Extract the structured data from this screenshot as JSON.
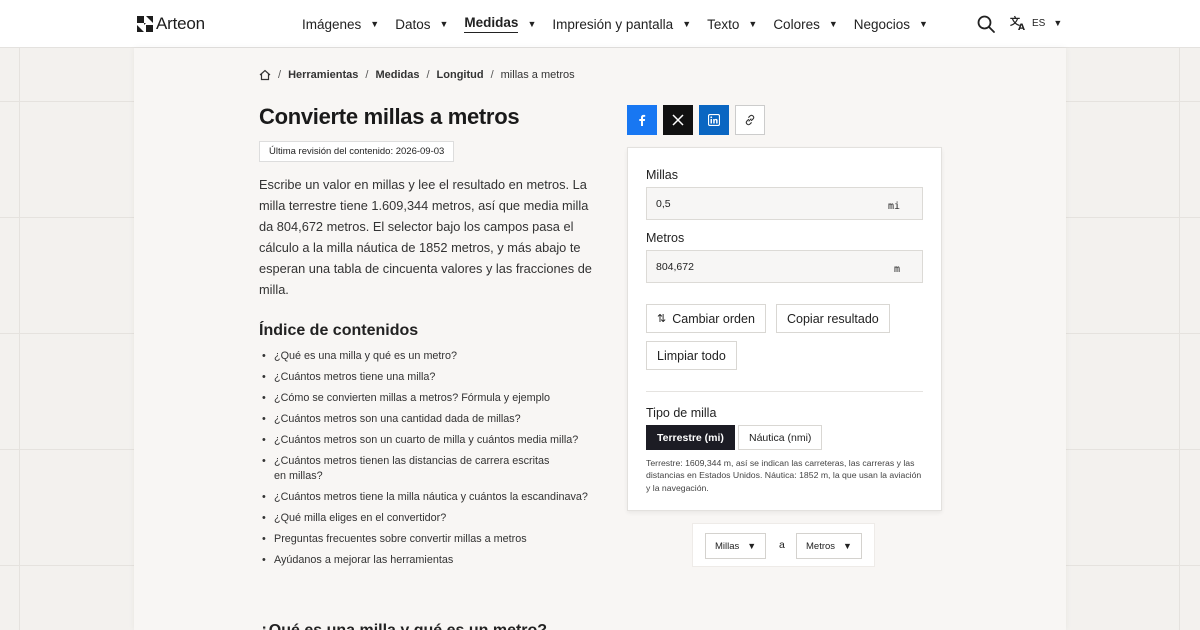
{
  "brand": {
    "name": "Arteon"
  },
  "nav": {
    "items": [
      {
        "label": "Imágenes"
      },
      {
        "label": "Datos"
      },
      {
        "label": "Medidas",
        "active": true
      },
      {
        "label": "Impresión y pantalla"
      },
      {
        "label": "Texto"
      },
      {
        "label": "Colores"
      },
      {
        "label": "Negocios"
      }
    ],
    "caret": "▼",
    "search_icon": "search-icon",
    "language": {
      "code": "ES",
      "icon": "translate-icon"
    }
  },
  "breadcrumb": {
    "home_icon": "home-icon",
    "items": [
      "Herramientas",
      "Medidas",
      "Longitud"
    ],
    "current": "millas a metros",
    "separator": "/"
  },
  "page": {
    "title": "Convierte millas a metros",
    "revision": "Última revisión del contenido: 2026-09-03",
    "intro": "Escribe un valor en millas y lee el resultado en metros. La milla terrestre tiene 1.609,344 metros, así que media milla da 804,672 metros. El selector bajo los campos pasa el cálculo a la milla náutica de 1852 metros, y más abajo te esperan una tabla de cincuenta valores y las fracciones de milla.",
    "toc_title": "Índice de contenidos",
    "toc": [
      "¿Qué es una milla y qué es un metro?",
      "¿Cuántos metros tiene una milla?",
      "¿Cómo se convierten millas a metros? Fórmula y ejemplo",
      "¿Cuántos metros son una cantidad dada de millas?",
      "¿Cuántos metros son un cuarto de milla y cuántos media milla?",
      "¿Cuántos metros tienen las distancias de carrera escritas en millas?",
      "¿Cuántos metros tiene la milla náutica y cuántos la escandinava?",
      "¿Qué milla eliges en el convertidor?",
      "Preguntas frecuentes sobre convertir millas a metros",
      "Ayúdanos a mejorar las herramientas"
    ],
    "next_heading": "¿Qué es una milla y qué es un metro?"
  },
  "share": {
    "icons": [
      "facebook-icon",
      "x-icon",
      "linkedin-icon",
      "link-icon"
    ],
    "colors": {
      "facebook": "#1877f2",
      "x": "#111111",
      "linkedin": "#0a66c2"
    }
  },
  "converter": {
    "from_label": "Millas",
    "from_value": "0,5",
    "from_unit": "mi",
    "to_label": "Metros",
    "to_value": "804,672",
    "to_unit": "m",
    "swap_icon": "⇅",
    "swap_label": "Cambiar orden",
    "copy_label": "Copiar resultado",
    "clear_label": "Limpiar todo",
    "mile_type_label": "Tipo de milla",
    "mile_types": [
      {
        "label": "Terrestre (mi)",
        "active": true
      },
      {
        "label": "Náutica (nmi)",
        "active": false
      }
    ],
    "note": "Terrestre: 1609,344 m, así se indican las carreteras, las carreras y las distancias en Estados Unidos. Náutica: 1852 m, la que usan la aviación y la navegación."
  },
  "unit_selector": {
    "from": "Millas",
    "connector": "a",
    "to": "Metros"
  },
  "colors": {
    "active_segment": "#1c1c24",
    "page_bg": "#f3f1ee"
  }
}
